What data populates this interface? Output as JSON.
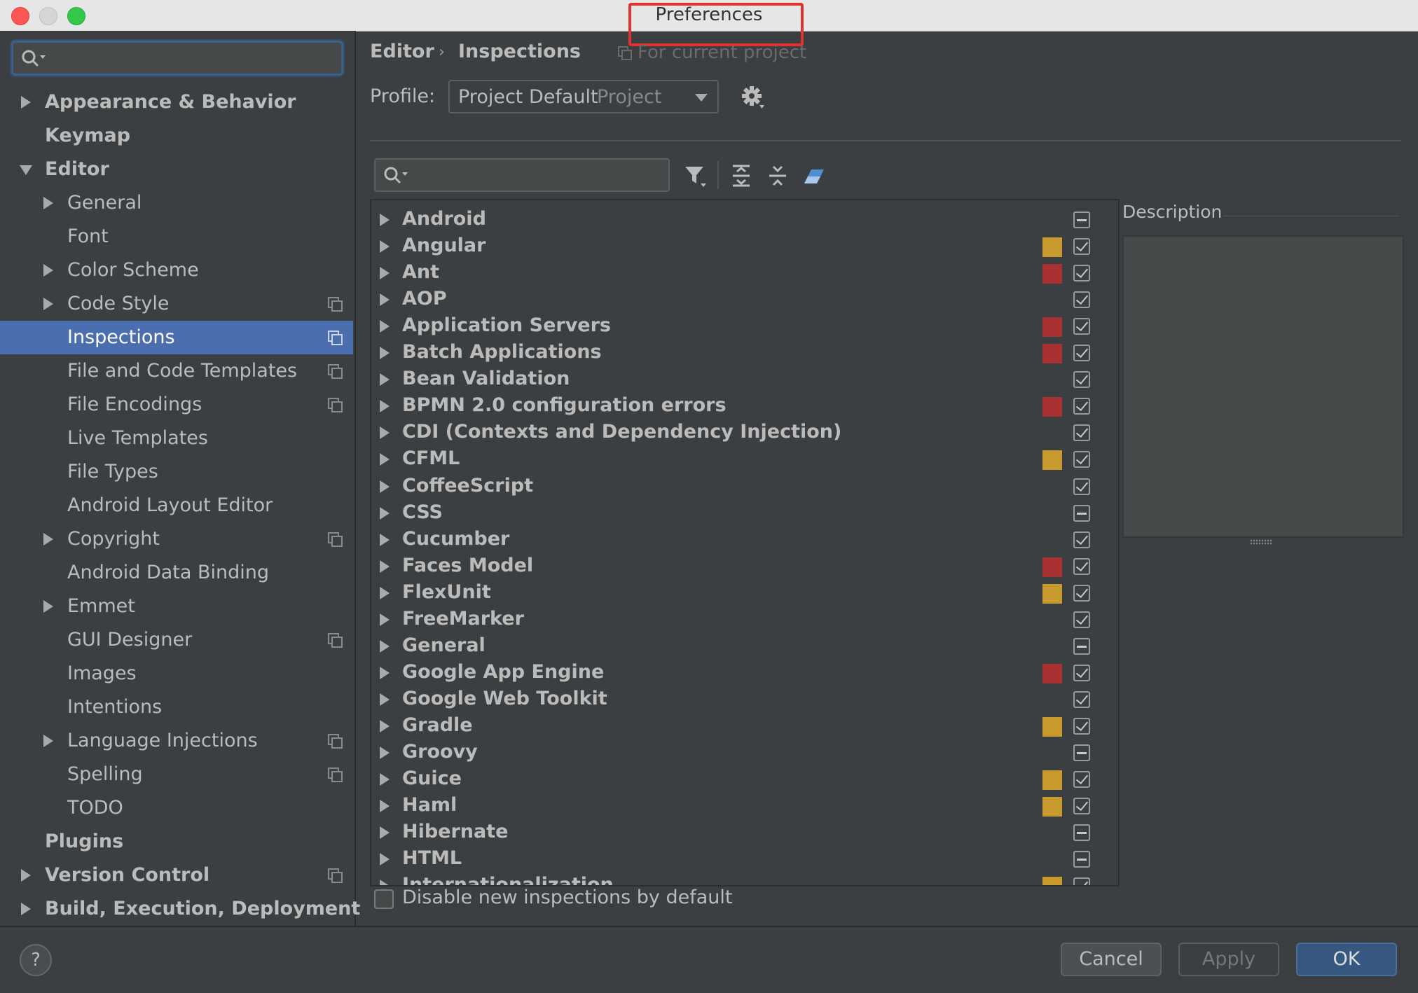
{
  "window": {
    "title": "Preferences"
  },
  "sidebar": {
    "search_placeholder": "",
    "items": [
      {
        "label": "Appearance & Behavior",
        "level": 0,
        "bold": true,
        "arrow": "right",
        "icon": false,
        "selected": false
      },
      {
        "label": "Keymap",
        "level": 0,
        "bold": true,
        "arrow": "none",
        "icon": false,
        "selected": false
      },
      {
        "label": "Editor",
        "level": 0,
        "bold": true,
        "arrow": "down",
        "icon": false,
        "selected": false
      },
      {
        "label": "General",
        "level": 1,
        "bold": false,
        "arrow": "right",
        "icon": false,
        "selected": false
      },
      {
        "label": "Font",
        "level": 1,
        "bold": false,
        "arrow": "none",
        "icon": false,
        "selected": false
      },
      {
        "label": "Color Scheme",
        "level": 1,
        "bold": false,
        "arrow": "right",
        "icon": false,
        "selected": false
      },
      {
        "label": "Code Style",
        "level": 1,
        "bold": false,
        "arrow": "right",
        "icon": true,
        "selected": false
      },
      {
        "label": "Inspections",
        "level": 1,
        "bold": false,
        "arrow": "none",
        "icon": true,
        "selected": true
      },
      {
        "label": "File and Code Templates",
        "level": 1,
        "bold": false,
        "arrow": "none",
        "icon": true,
        "selected": false
      },
      {
        "label": "File Encodings",
        "level": 1,
        "bold": false,
        "arrow": "none",
        "icon": true,
        "selected": false
      },
      {
        "label": "Live Templates",
        "level": 1,
        "bold": false,
        "arrow": "none",
        "icon": false,
        "selected": false
      },
      {
        "label": "File Types",
        "level": 1,
        "bold": false,
        "arrow": "none",
        "icon": false,
        "selected": false
      },
      {
        "label": "Android Layout Editor",
        "level": 1,
        "bold": false,
        "arrow": "none",
        "icon": false,
        "selected": false
      },
      {
        "label": "Copyright",
        "level": 1,
        "bold": false,
        "arrow": "right",
        "icon": true,
        "selected": false
      },
      {
        "label": "Android Data Binding",
        "level": 1,
        "bold": false,
        "arrow": "none",
        "icon": false,
        "selected": false
      },
      {
        "label": "Emmet",
        "level": 1,
        "bold": false,
        "arrow": "right",
        "icon": false,
        "selected": false
      },
      {
        "label": "GUI Designer",
        "level": 1,
        "bold": false,
        "arrow": "none",
        "icon": true,
        "selected": false
      },
      {
        "label": "Images",
        "level": 1,
        "bold": false,
        "arrow": "none",
        "icon": false,
        "selected": false
      },
      {
        "label": "Intentions",
        "level": 1,
        "bold": false,
        "arrow": "none",
        "icon": false,
        "selected": false
      },
      {
        "label": "Language Injections",
        "level": 1,
        "bold": false,
        "arrow": "right",
        "icon": true,
        "selected": false
      },
      {
        "label": "Spelling",
        "level": 1,
        "bold": false,
        "arrow": "none",
        "icon": true,
        "selected": false
      },
      {
        "label": "TODO",
        "level": 1,
        "bold": false,
        "arrow": "none",
        "icon": false,
        "selected": false
      },
      {
        "label": "Plugins",
        "level": 0,
        "bold": true,
        "arrow": "none",
        "icon": false,
        "selected": false
      },
      {
        "label": "Version Control",
        "level": 0,
        "bold": true,
        "arrow": "right",
        "icon": true,
        "selected": false
      },
      {
        "label": "Build, Execution, Deployment",
        "level": 0,
        "bold": true,
        "arrow": "right",
        "icon": false,
        "selected": false
      }
    ]
  },
  "header": {
    "breadcrumb": [
      "Editor",
      "Inspections"
    ],
    "breadcrumb_separator": "›",
    "scope_note": "For current project",
    "profile_label": "Profile:",
    "profile_value": "Project Default",
    "profile_scope": "Project"
  },
  "toolbar": {
    "search_placeholder": "",
    "icons": [
      "filter-icon",
      "expand-all-icon",
      "collapse-all-icon",
      "reset-eraser-icon"
    ]
  },
  "colors": {
    "warning": "#c79a2e",
    "error": "#a83232",
    "selection": "#4b6eaf"
  },
  "inspections": [
    {
      "label": "Android",
      "severity": "none",
      "state": "partial"
    },
    {
      "label": "Angular",
      "severity": "warning",
      "state": "checked"
    },
    {
      "label": "Ant",
      "severity": "error",
      "state": "checked"
    },
    {
      "label": "AOP",
      "severity": "none",
      "state": "checked"
    },
    {
      "label": "Application Servers",
      "severity": "error",
      "state": "checked"
    },
    {
      "label": "Batch Applications",
      "severity": "error",
      "state": "checked"
    },
    {
      "label": "Bean Validation",
      "severity": "none",
      "state": "checked"
    },
    {
      "label": "BPMN 2.0 configuration errors",
      "severity": "error",
      "state": "checked"
    },
    {
      "label": "CDI (Contexts and Dependency Injection)",
      "severity": "none",
      "state": "checked"
    },
    {
      "label": "CFML",
      "severity": "warning",
      "state": "checked"
    },
    {
      "label": "CoffeeScript",
      "severity": "none",
      "state": "checked"
    },
    {
      "label": "CSS",
      "severity": "none",
      "state": "partial"
    },
    {
      "label": "Cucumber",
      "severity": "none",
      "state": "checked"
    },
    {
      "label": "Faces Model",
      "severity": "error",
      "state": "checked"
    },
    {
      "label": "FlexUnit",
      "severity": "warning",
      "state": "checked"
    },
    {
      "label": "FreeMarker",
      "severity": "none",
      "state": "checked"
    },
    {
      "label": "General",
      "severity": "none",
      "state": "partial"
    },
    {
      "label": "Google App Engine",
      "severity": "error",
      "state": "checked"
    },
    {
      "label": "Google Web Toolkit",
      "severity": "none",
      "state": "checked"
    },
    {
      "label": "Gradle",
      "severity": "warning",
      "state": "checked"
    },
    {
      "label": "Groovy",
      "severity": "none",
      "state": "partial"
    },
    {
      "label": "Guice",
      "severity": "warning",
      "state": "checked"
    },
    {
      "label": "Haml",
      "severity": "warning",
      "state": "checked"
    },
    {
      "label": "Hibernate",
      "severity": "none",
      "state": "partial"
    },
    {
      "label": "HTML",
      "severity": "none",
      "state": "partial"
    },
    {
      "label": "Internationalization",
      "severity": "warning",
      "state": "checked"
    }
  ],
  "description": {
    "label": "Description"
  },
  "footer": {
    "disable_label": "Disable new inspections by default",
    "help_label": "?",
    "cancel_label": "Cancel",
    "apply_label": "Apply",
    "ok_label": "OK"
  }
}
